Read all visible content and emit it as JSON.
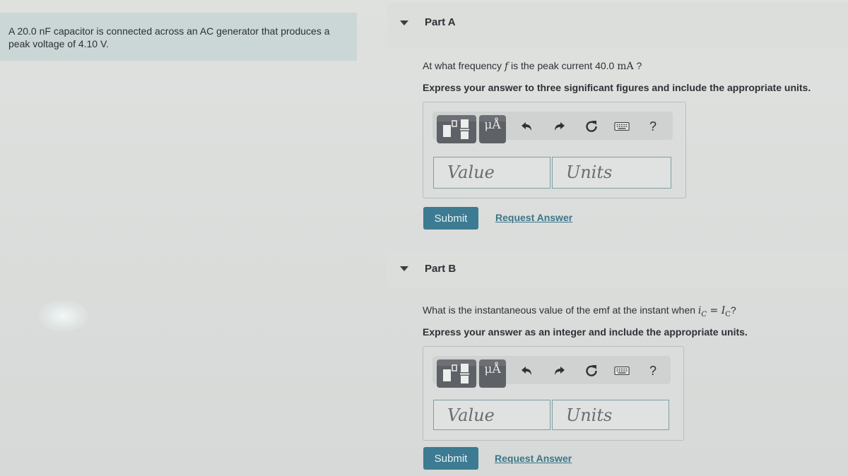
{
  "problem": {
    "statement": "A 20.0 nF capacitor is connected across an AC generator that produces a peak voltage of 4.10 V."
  },
  "parts": [
    {
      "title": "Part A",
      "question_prefix": "At what frequency ",
      "question_var": "f",
      "question_middle": " is the peak current 40.0 ",
      "question_unit": "mA",
      "question_suffix": " ?",
      "instruction": "Express your answer to three significant figures and include the appropriate units.",
      "value_placeholder": "Value",
      "units_placeholder": "Units",
      "submit_label": "Submit",
      "request_label": "Request Answer"
    },
    {
      "title": "Part B",
      "question_prefix": "What is the instantaneous value of the emf at the instant when ",
      "question_lhs": "i",
      "question_lhs_sub": "C",
      "question_eq": " = ",
      "question_rhs": "I",
      "question_rhs_sub": "C",
      "question_suffix": "?",
      "instruction": "Express your answer as an integer and include the appropriate units.",
      "value_placeholder": "Value",
      "units_placeholder": "Units",
      "submit_label": "Submit",
      "request_label": "Request Answer"
    }
  ],
  "toolbar": {
    "units_glyph": "μÅ",
    "help_glyph": "?",
    "icons": [
      "templates-icon",
      "units-icon",
      "undo-icon",
      "redo-icon",
      "reset-icon",
      "keyboard-icon",
      "help-icon"
    ]
  },
  "colors": {
    "intro_bg": "#cbd7d6",
    "submit_bg": "#3c7b91",
    "link": "#3b7689",
    "toolbar_button": "#5e6166"
  }
}
